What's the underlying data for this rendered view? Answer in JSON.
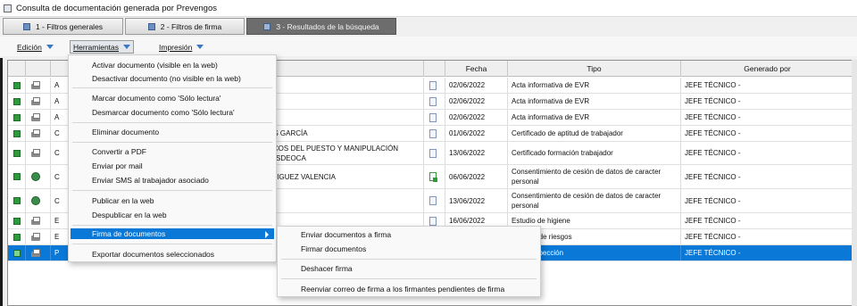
{
  "window": {
    "title": "Consulta de documentación generada por Prevengos"
  },
  "tabs": [
    {
      "label": "1 - Filtros generales"
    },
    {
      "label": "2 - Filtros de firma"
    },
    {
      "label": "3 - Resultados de la búsqueda"
    }
  ],
  "toolbar": {
    "edicion": "Edición",
    "herramientas": "Herramientas",
    "impresion": "Impresión"
  },
  "grid": {
    "headers": {
      "fecha": "Fecha",
      "tipo": "Tipo",
      "generado_por": "Generado por"
    },
    "rows": [
      {
        "key": "A",
        "name": "",
        "fecha": "02/06/2022",
        "tipo": "Acta informativa de EVR",
        "generado": "JEFE TÉCNICO -"
      },
      {
        "key": "A",
        "name": "",
        "fecha": "02/06/2022",
        "tipo": "Acta informativa de EVR",
        "generado": "JEFE TÉCNICO -"
      },
      {
        "key": "A",
        "name": "",
        "fecha": "02/06/2022",
        "tipo": "Acta informativa de EVR",
        "generado": "JEFE TÉCNICO -"
      },
      {
        "key": "C",
        "name": "IAS GARCÍA",
        "fecha": "01/06/2022",
        "tipo": "Certificado de aptitud de trabajador",
        "generado": "JEFE TÉCNICO -"
      },
      {
        "key": "C",
        "name": "FICOS DEL PUESTO Y MANIPULACIÓN",
        "name2": "TESDEOCA",
        "fecha": "13/06/2022",
        "tipo": "Certificado formación trabajador",
        "generado": "JEFE TÉCNICO -"
      },
      {
        "key": "C",
        "name": "DRIGUEZ VALENCIA",
        "fecha": "06/06/2022",
        "tipo": "Consentimiento de cesión de datos de caracter",
        "tipo2": "personal",
        "generado": "JEFE TÉCNICO -"
      },
      {
        "key": "C",
        "name": "A",
        "fecha": "13/06/2022",
        "tipo": "Consentimiento de cesión de datos de caracter",
        "tipo2": "personal",
        "generado": "JEFE TÉCNICO -"
      },
      {
        "key": "E",
        "name": "",
        "fecha": "16/06/2022",
        "tipo": "Estudio de higiene",
        "generado": "JEFE TÉCNICO -"
      },
      {
        "key": "E",
        "name": "",
        "fecha": "",
        "tipo": "n de riesgos",
        "generado": "JEFE TÉCNICO -"
      },
      {
        "key": "P",
        "name": "",
        "fecha": "",
        "tipo": "nspección",
        "generado": "JEFE TÉCNICO -"
      }
    ]
  },
  "menu": {
    "items": [
      "Activar documento (visible en la web)",
      "Desactivar documento (no visible en la web)",
      "Marcar documento como 'Sólo lectura'",
      "Desmarcar documento como 'Sólo lectura'",
      "Eliminar documento",
      "Convertir a PDF",
      "Enviar por mail",
      "Enviar SMS al trabajador asociado",
      "Publicar en la web",
      "Despublicar en la web",
      "Firma de documentos",
      "Exportar documentos seleccionados"
    ]
  },
  "submenu": {
    "items": [
      "Enviar documentos a firma",
      "Firmar documentos",
      "Deshacer firma",
      "Reenviar correo de firma a los firmantes pendientes de firma"
    ]
  }
}
